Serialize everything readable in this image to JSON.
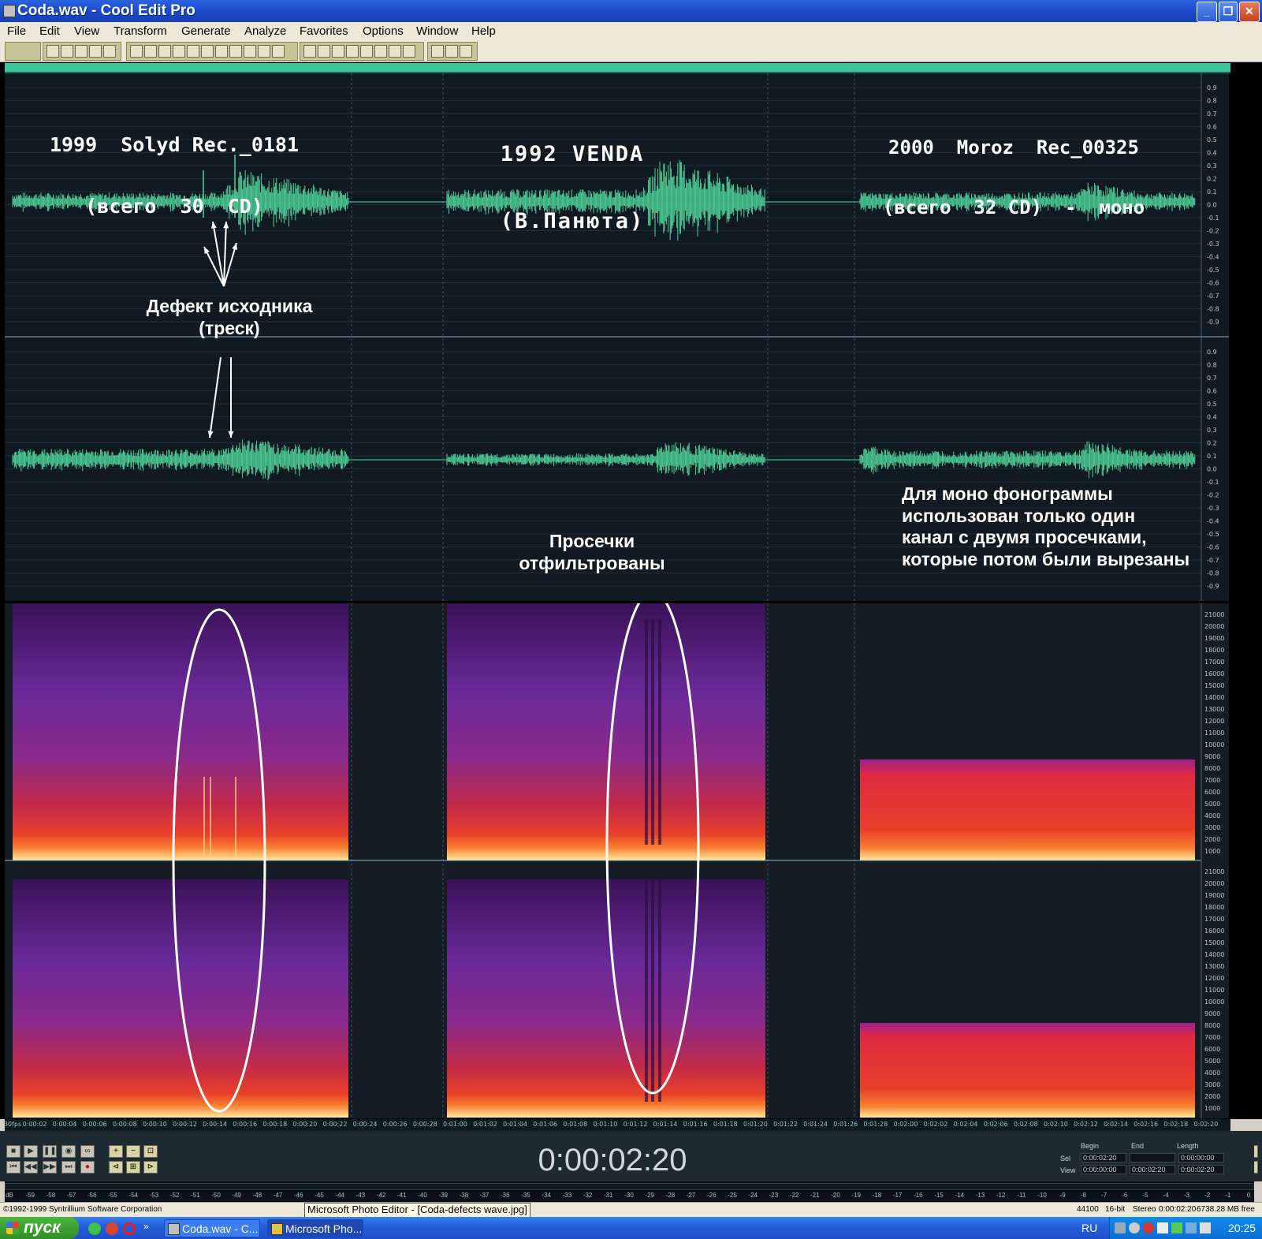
{
  "window": {
    "title": "Coda.wav - Cool Edit Pro",
    "min_icon": "minimize-icon",
    "max_icon": "restore-icon",
    "close_icon": "close-icon"
  },
  "menu": [
    "File",
    "Edit",
    "View",
    "Transform",
    "Generate",
    "Analyze",
    "Favorites",
    "Options",
    "Window",
    "Help"
  ],
  "colors": {
    "waveform": "#4ed29a",
    "wave_bg": "#111a22",
    "spectral_hot": "#ffe8a0",
    "spectral_mid": "#e0302a",
    "spectral_low": "#4a1a7a",
    "annotation": "#ffffff"
  },
  "segments": [
    {
      "title_line1": "1999  Solyd Rec._0181",
      "title_line2": "(всего  30  CD)"
    },
    {
      "title_line1": "1992 VENDA",
      "title_line2": "(В.Панюта)"
    },
    {
      "title_line1": "2000  Moroz  Rec_00325",
      "title_line2": "(всего  32 CD)  -  моно"
    }
  ],
  "annotations": {
    "defect_line1": "Дефект исходника",
    "defect_line2": "(треск)",
    "filtered_line1": "Просечки",
    "filtered_line2": "отфильтрованы",
    "mono_line1": "Для моно фонограммы",
    "mono_line2": "использован только один",
    "mono_line3": "канал  с двумя просечками,",
    "mono_line4": "которые потом были вырезаны"
  },
  "amplitude_scale": [
    "0.9",
    "0.8",
    "0.7",
    "0.6",
    "0.5",
    "0.4",
    "0.3",
    "0.2",
    "0.1",
    "0.0",
    "-0.1",
    "-0.2",
    "-0.3",
    "-0.4",
    "-0.5",
    "-0.6",
    "-0.7",
    "-0.8",
    "-0.9"
  ],
  "frequency_scale": [
    "21000",
    "20000",
    "19000",
    "18000",
    "17000",
    "16000",
    "15000",
    "14000",
    "13000",
    "12000",
    "11000",
    "10000",
    "9000",
    "8000",
    "7000",
    "6000",
    "5000",
    "4000",
    "3000",
    "2000",
    "1000"
  ],
  "time_ruler": [
    "30fps",
    "0:00:02",
    "0:00:04",
    "0:00:06",
    "0:00:08",
    "0:00:10",
    "0:00:12",
    "0:00:14",
    "0:00:16",
    "0:00:18",
    "0:00:20",
    "0:00:22",
    "0:00:24",
    "0:00:26",
    "0:00:28",
    "0:01:00",
    "0:01:02",
    "0:01:04",
    "0:01:06",
    "0:01:08",
    "0:01:10",
    "0:01:12",
    "0:01:14",
    "0:01:16",
    "0:01:18",
    "0:01:20",
    "0:01:22",
    "0:01:24",
    "0:01:26",
    "0:01:28",
    "0:02:00",
    "0:02:02",
    "0:02:04",
    "0:02:06",
    "0:02:08",
    "0:02:10",
    "0:02:12",
    "0:02:14",
    "0:02:16",
    "0:02:18",
    "0:02:20"
  ],
  "time_display": "0:00:02:20",
  "selection": {
    "begin_label": "Begin",
    "end_label": "End",
    "length_label": "Length",
    "sel_label": "Sel",
    "view_label": "View",
    "sel_begin": "0:00:02:20",
    "sel_end": "",
    "sel_length": "0:00:00:00",
    "view_begin": "0:00:00:00",
    "view_end": "0:00:02:20",
    "view_length": "0:00:02:20"
  },
  "db_scale": [
    "dB",
    "-59",
    "-58",
    "-57",
    "-56",
    "-55",
    "-54",
    "-53",
    "-52",
    "-51",
    "-50",
    "-49",
    "-48",
    "-47",
    "-46",
    "-45",
    "-44",
    "-43",
    "-42",
    "-41",
    "-40",
    "-39",
    "-38",
    "-37",
    "-36",
    "-35",
    "-34",
    "-33",
    "-32",
    "-31",
    "-30",
    "-29",
    "-28",
    "-27",
    "-26",
    "-25",
    "-24",
    "-23",
    "-22",
    "-21",
    "-20",
    "-19",
    "-18",
    "-17",
    "-16",
    "-15",
    "-14",
    "-13",
    "-12",
    "-11",
    "-10",
    "-9",
    "-8",
    "-7",
    "-6",
    "-5",
    "-4",
    "-3",
    "-2",
    "-1",
    "0"
  ],
  "status": {
    "copyright": "©1992-1999 Syntrillium Software Corporation",
    "tooltip": "Microsoft Photo Editor - [Coda-defects wave.jpg]",
    "sample_rate": "44100",
    "bit_depth": "16-bit",
    "channels": "Stereo",
    "time": "0:00:02:20",
    "free": "6738.28 MB free"
  },
  "taskbar": {
    "start": "пуск",
    "tasks": [
      "Coda.wav - C...",
      "Microsoft Pho..."
    ],
    "lang": "RU",
    "clock": "20:25"
  }
}
